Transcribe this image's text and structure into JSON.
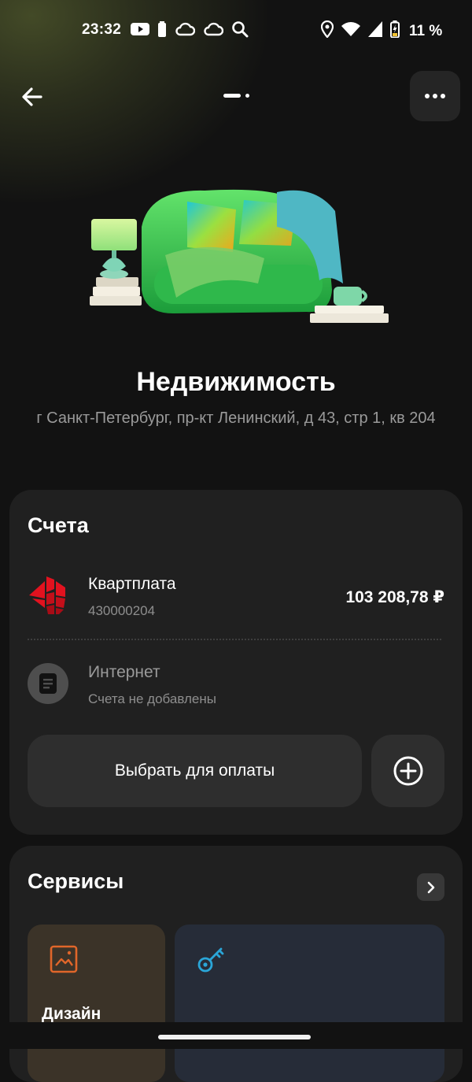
{
  "status_bar": {
    "time": "23:32",
    "battery": "11 %"
  },
  "header": {
    "pager_current": 1,
    "pager_total": 2
  },
  "property": {
    "title": "Недвижимость",
    "address": "г Санкт-Петербург, пр-кт Ленинский, д 43, стр 1, кв 204"
  },
  "accounts": {
    "title": "Счета",
    "items": [
      {
        "name": "Квартплата",
        "number": "430000204",
        "amount": "103 208,78 ₽",
        "icon": "building-logo-icon"
      },
      {
        "name": "Интернет",
        "number": "Счета не добавлены",
        "amount": "",
        "icon": "document-icon"
      }
    ],
    "pay_button": "Выбрать для оплаты"
  },
  "services": {
    "title": "Сервисы",
    "tiles": [
      {
        "label": "Дизайн",
        "icon": "image-frame-icon",
        "accent": "#e0662a"
      },
      {
        "label": "",
        "icon": "key-icon",
        "accent": "#2aa6d8"
      }
    ]
  },
  "colors": {
    "background": "#121212",
    "card": "#202020",
    "button": "#2e2e2e",
    "brand_red": "#e2121f"
  }
}
